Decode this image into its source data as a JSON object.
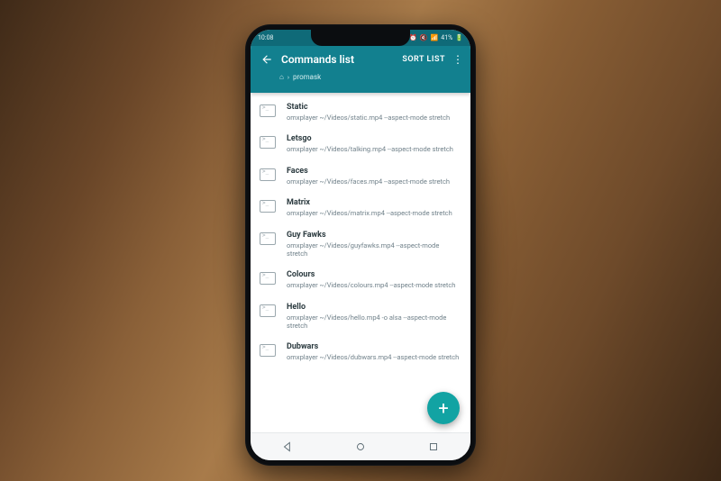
{
  "status": {
    "time": "10:08",
    "battery": "41%",
    "icons": [
      "✱",
      "⏰",
      "🔇",
      "📶",
      "🔋"
    ]
  },
  "appbar": {
    "title": "Commands list",
    "sort_label": "SORT LIST",
    "breadcrumb_root_icon": "⌂",
    "breadcrumb": "promask"
  },
  "fab": {
    "label": "+"
  },
  "commands": [
    {
      "title": "Static",
      "sub": "omxplayer ~/Videos/static.mp4 --aspect-mode stretch"
    },
    {
      "title": "Letsgo",
      "sub": "omxplayer ~/Videos/talking.mp4 --aspect-mode stretch"
    },
    {
      "title": "Faces",
      "sub": "omxplayer ~/Videos/faces.mp4 --aspect-mode stretch"
    },
    {
      "title": "Matrix",
      "sub": "omxplayer ~/Videos/matrix.mp4 --aspect-mode stretch"
    },
    {
      "title": "Guy Fawks",
      "sub": "omxplayer ~/Videos/guyfawks.mp4 --aspect-mode stretch"
    },
    {
      "title": "Colours",
      "sub": "omxplayer ~/Videos/colours.mp4 --aspect-mode stretch"
    },
    {
      "title": "Hello",
      "sub": "omxplayer ~/Videos/hello.mp4 -o alsa --aspect-mode stretch"
    },
    {
      "title": "Dubwars",
      "sub": "omxplayer ~/Videos/dubwars.mp4 --aspect-mode stretch"
    }
  ],
  "colors": {
    "primary": "#12808f",
    "primary_dark": "#0f6a78",
    "accent": "#12a3a3"
  }
}
